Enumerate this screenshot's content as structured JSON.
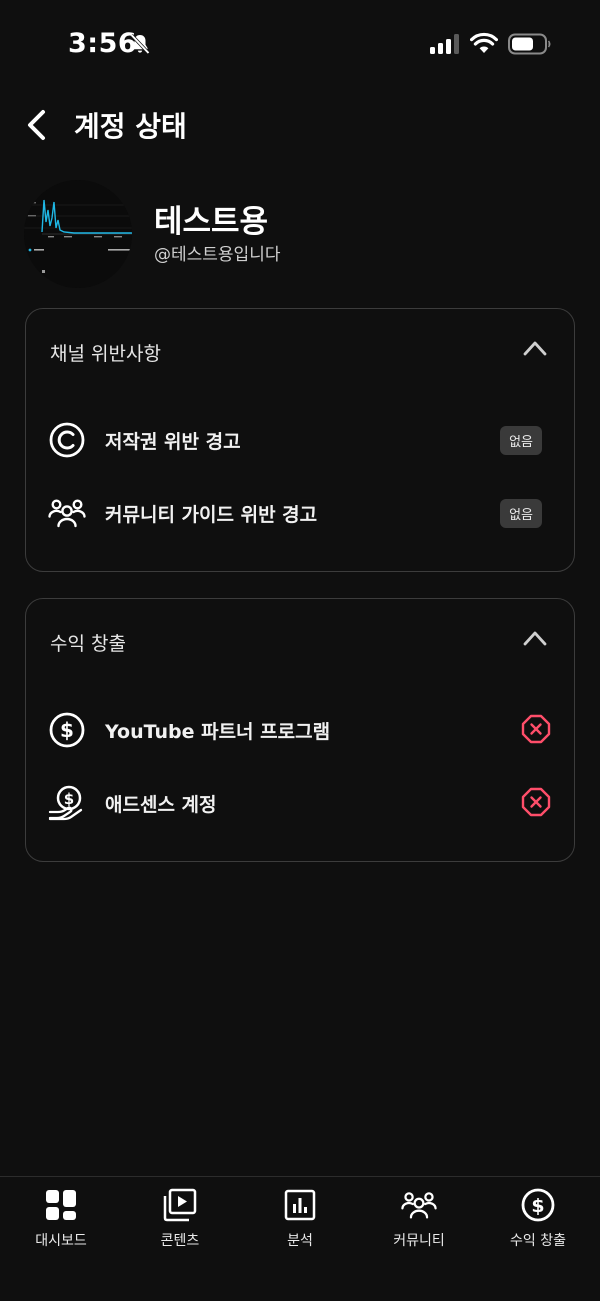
{
  "status_bar": {
    "time": "3:56"
  },
  "header": {
    "title": "계정 상태"
  },
  "channel": {
    "name": "테스트용",
    "handle": "@테스트용입니다"
  },
  "violations_card": {
    "title": "채널 위반사항",
    "rows": [
      {
        "label": "저작권 위반 경고",
        "badge": "없음",
        "icon": "copyright-icon"
      },
      {
        "label": "커뮤니티 가이드 위반 경고",
        "badge": "없음",
        "icon": "community-icon"
      }
    ]
  },
  "monetization_card": {
    "title": "수익 창출",
    "rows": [
      {
        "label": "YouTube 파트너 프로그램",
        "status": "not-eligible",
        "icon": "dollar-circle-icon"
      },
      {
        "label": "애드센스 계정",
        "status": "not-eligible",
        "icon": "hand-coin-icon"
      }
    ]
  },
  "bottom_nav": {
    "items": [
      {
        "label": "대시보드",
        "icon": "dashboard-icon"
      },
      {
        "label": "콘텐츠",
        "icon": "content-icon"
      },
      {
        "label": "분석",
        "icon": "analytics-icon"
      },
      {
        "label": "커뮤니티",
        "icon": "community-icon"
      },
      {
        "label": "수익 창출",
        "icon": "monetization-icon"
      }
    ]
  },
  "colors": {
    "background": "#0f0f0f",
    "card_border": "#3c3c3c",
    "badge_bg": "#3a3a3a",
    "error_red": "#ff4e6a",
    "chart_cyan": "#1fb8e6"
  }
}
